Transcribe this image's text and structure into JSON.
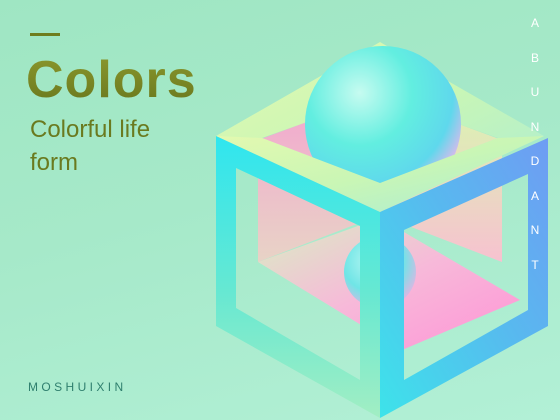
{
  "title": "Colors",
  "subtitle_line1": "Colorful life",
  "subtitle_line2": "form",
  "brand": "MOSHUIXIN",
  "vertical_letters": [
    "A",
    "B",
    "U",
    "N",
    "D",
    "A",
    "N",
    "T"
  ],
  "colors": {
    "title_olive": "#6f7d1e",
    "background_mint": "#a6e9c9",
    "cube_cyan": "#3fe0ec",
    "cube_pink": "#ff9fd8",
    "cube_blue": "#6aa8f5",
    "cube_lime": "#d9f7a8"
  }
}
